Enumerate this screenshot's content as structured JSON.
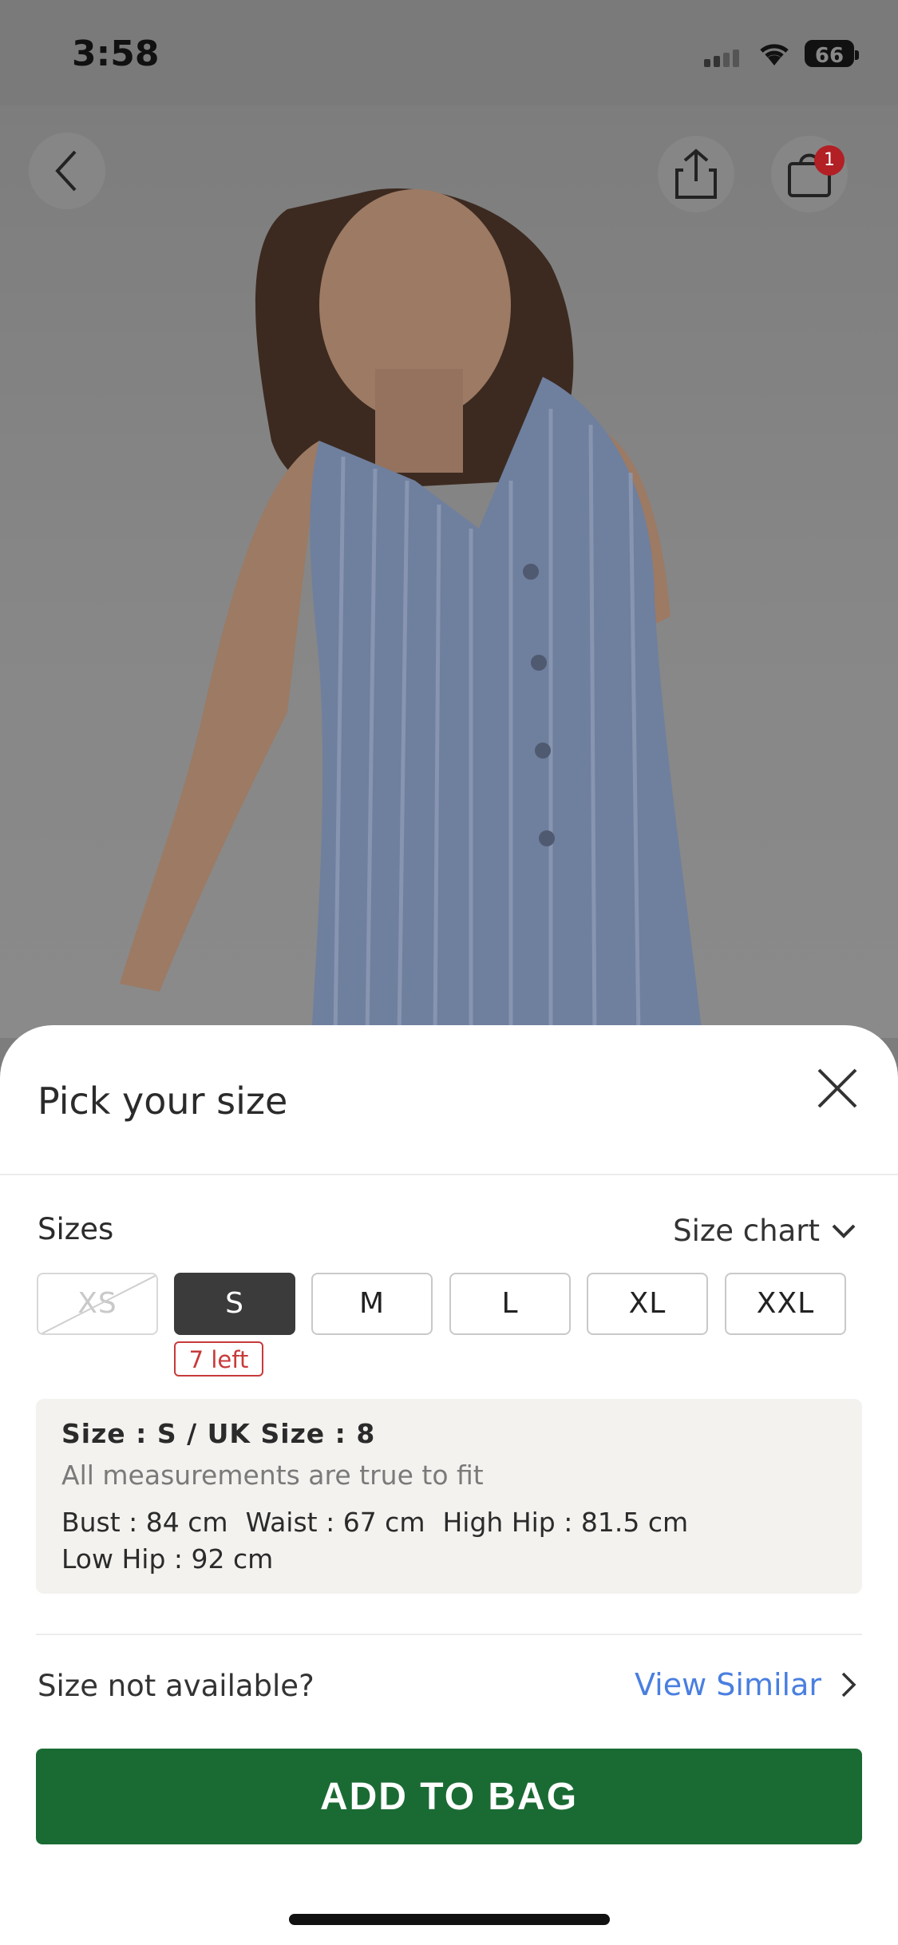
{
  "status_bar": {
    "time": "3:58",
    "battery": "66"
  },
  "top_bar": {
    "back_icon": "chevron-left-icon",
    "share_icon": "share-icon",
    "bag_icon": "shopping-bag-icon",
    "bag_count": "1"
  },
  "sheet": {
    "title": "Pick your size",
    "close_icon": "close-icon",
    "sizes_label": "Sizes",
    "size_chart_label": "Size chart",
    "sizes": [
      {
        "label": "XS",
        "state": "unavailable"
      },
      {
        "label": "S",
        "state": "selected"
      },
      {
        "label": "M",
        "state": "available"
      },
      {
        "label": "L",
        "state": "available"
      },
      {
        "label": "XL",
        "state": "available"
      },
      {
        "label": "XXL",
        "state": "available"
      }
    ],
    "stock_tag": "7 left",
    "info": {
      "size_line": "Size : S / UK Size : 8",
      "note": "All measurements are true to fit",
      "bust": "Bust : 84 cm",
      "waist": "Waist : 67 cm",
      "high_hip": "High Hip : 81.5 cm",
      "low_hip": "Low Hip : 92 cm"
    },
    "not_available_text": "Size not available?",
    "view_similar_label": "View Similar",
    "add_to_bag_label": "ADD TO BAG"
  },
  "colors": {
    "selected_size": "#3b3b3b",
    "stock_tag": "#c73a3a",
    "link": "#4a7fe0",
    "primary_button": "#1a6b33",
    "badge": "#b21f24"
  }
}
